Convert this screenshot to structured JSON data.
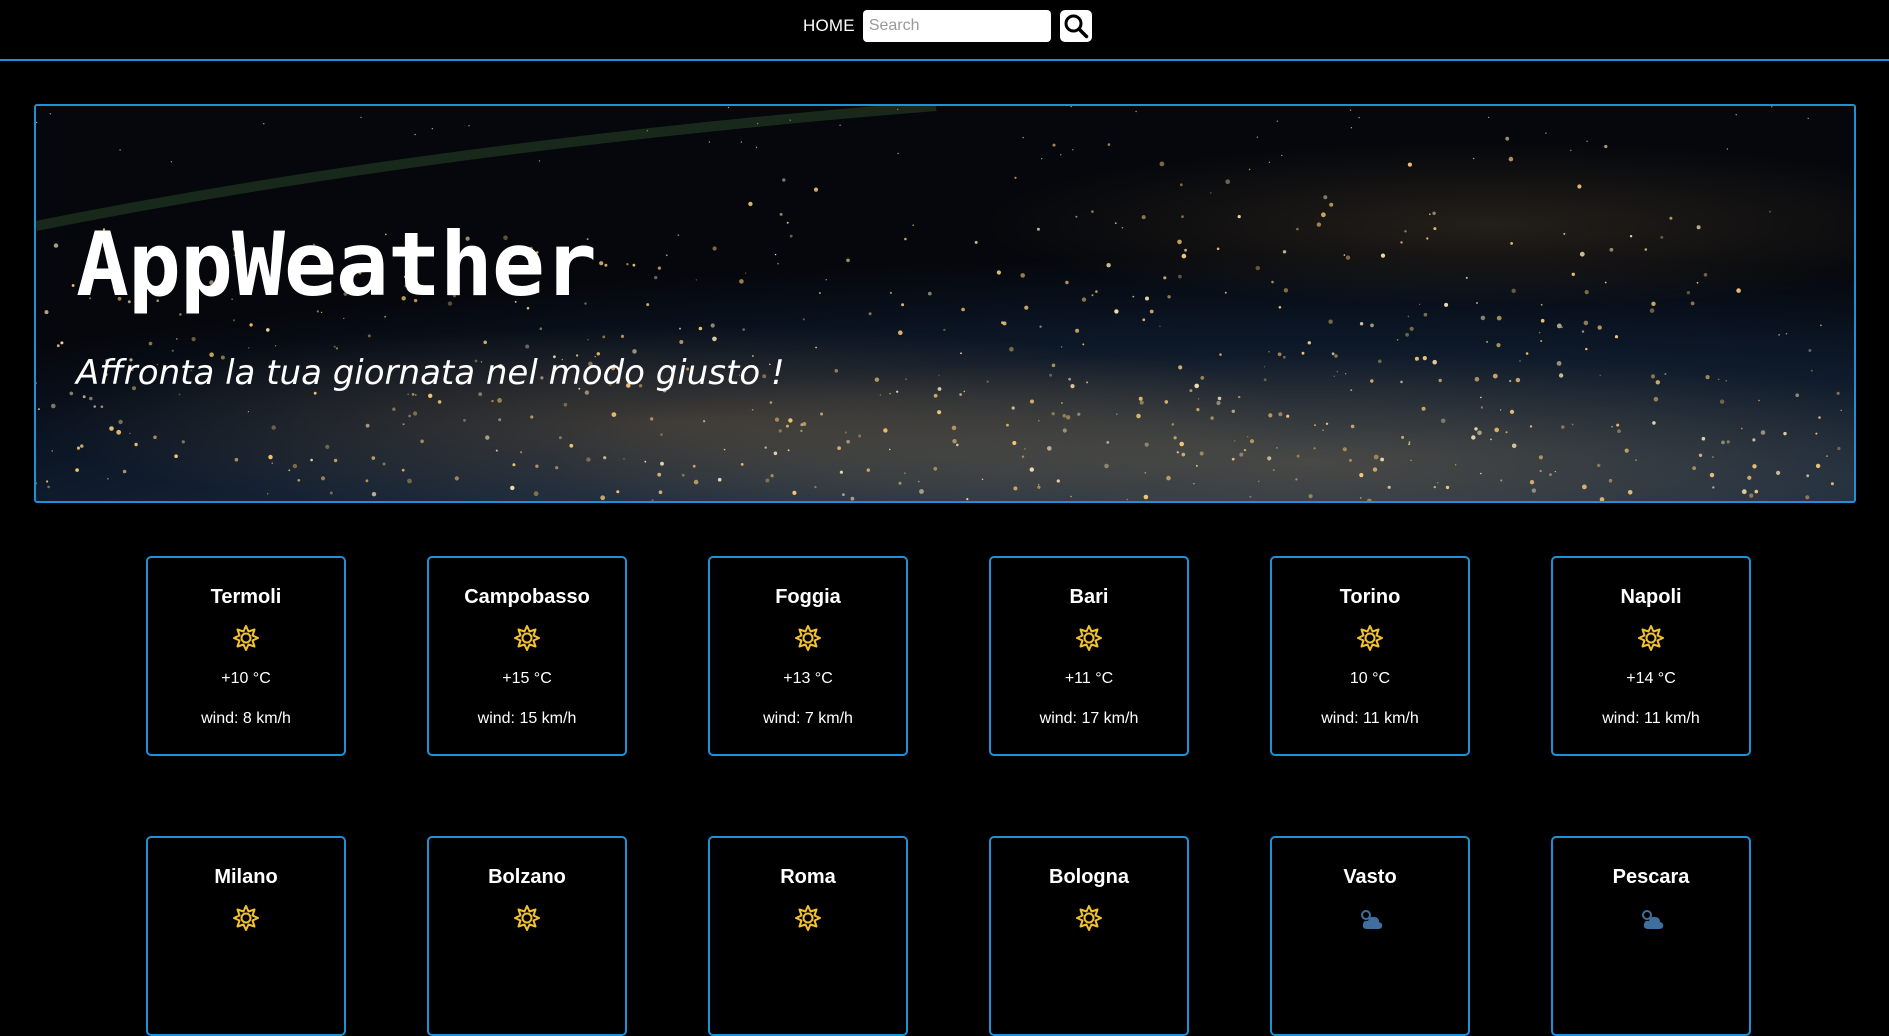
{
  "nav": {
    "home_label": "HOME",
    "search_placeholder": "Search",
    "search_icon": "search-icon"
  },
  "hero": {
    "title": "AppWeather",
    "subtitle": "Affronta la tua giornata nel modo giusto !",
    "background": "earth-at-night-image"
  },
  "colors": {
    "accent": "#1e90d6",
    "sun": "#f2c230",
    "cloud": "#3f6f9e",
    "background": "#000000"
  },
  "cities": [
    {
      "name": "Termoli",
      "icon": "sun-icon",
      "temp": "+10 °C",
      "wind": "wind: 8 km/h"
    },
    {
      "name": "Campobasso",
      "icon": "sun-icon",
      "temp": "+15 °C",
      "wind": "wind: 15 km/h"
    },
    {
      "name": "Foggia",
      "icon": "sun-icon",
      "temp": "+13 °C",
      "wind": "wind: 7 km/h"
    },
    {
      "name": "Bari",
      "icon": "sun-icon",
      "temp": "+11 °C",
      "wind": "wind: 17 km/h"
    },
    {
      "name": "Torino",
      "icon": "sun-icon",
      "temp": "10 °C",
      "wind": "wind: 11 km/h"
    },
    {
      "name": "Napoli",
      "icon": "sun-icon",
      "temp": "+14 °C",
      "wind": "wind: 11 km/h"
    },
    {
      "name": "Milano",
      "icon": "sun-icon"
    },
    {
      "name": "Bolzano",
      "icon": "sun-icon"
    },
    {
      "name": "Roma",
      "icon": "sun-icon"
    },
    {
      "name": "Bologna",
      "icon": "sun-icon"
    },
    {
      "name": "Vasto",
      "icon": "sun-cloud-icon"
    },
    {
      "name": "Pescara",
      "icon": "sun-cloud-icon"
    }
  ]
}
